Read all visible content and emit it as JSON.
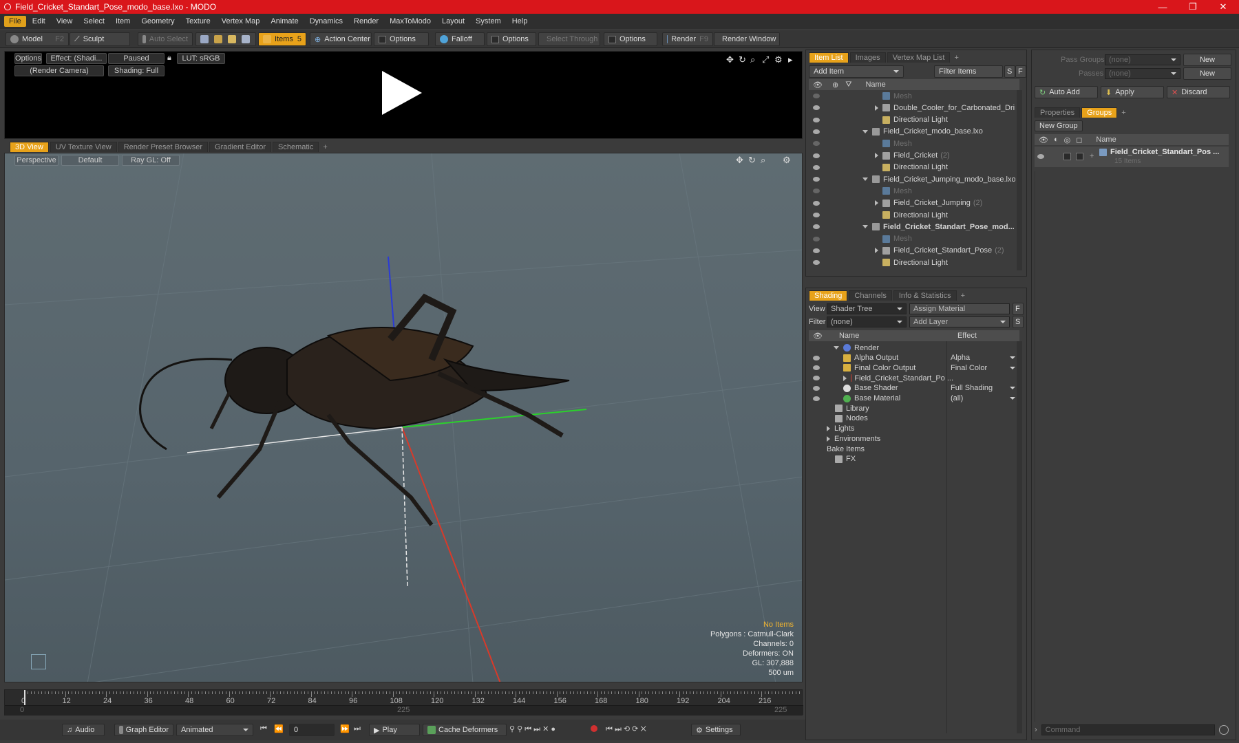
{
  "window": {
    "title": "Field_Cricket_Standart_Pose_modo_base.lxo - MODO",
    "minimize": "—",
    "maximize": "❐",
    "close": "✕"
  },
  "menu": [
    "File",
    "Edit",
    "View",
    "Select",
    "Item",
    "Geometry",
    "Texture",
    "Vertex Map",
    "Animate",
    "Dynamics",
    "Render",
    "MaxToModo",
    "Layout",
    "System",
    "Help"
  ],
  "toolbar": {
    "model": "Model",
    "model_key": "F2",
    "sculpt": "Sculpt",
    "auto_select": "Auto Select",
    "items": "Items",
    "items_key": "5",
    "action_center": "Action Center",
    "options1": "Options",
    "falloff": "Falloff",
    "options2": "Options",
    "select_through": "Select Through",
    "options3": "Options",
    "render": "Render",
    "render_key": "F9",
    "render_window": "Render Window"
  },
  "render_preview": {
    "options": "Options",
    "effect": "Effect: (Shadi...",
    "paused": "Paused",
    "lut": "LUT: sRGB",
    "camera": "(Render Camera)",
    "shading": "Shading: Full"
  },
  "view_tabs": [
    "3D View",
    "UV Texture View",
    "Render Preset Browser",
    "Gradient Editor",
    "Schematic"
  ],
  "viewport": {
    "perspective": "Perspective",
    "default": "Default",
    "raygl": "Ray GL: Off",
    "stats": {
      "no_items": "No Items",
      "polygons": "Polygons : Catmull-Clark",
      "channels": "Channels: 0",
      "deformers": "Deformers: ON",
      "gl": "GL: 307,888",
      "scale": "500 um"
    }
  },
  "timeline": {
    "ticks": [
      "0",
      "12",
      "24",
      "36",
      "48",
      "60",
      "72",
      "84",
      "96",
      "108",
      "120",
      "132",
      "144",
      "156",
      "168",
      "180",
      "192",
      "204",
      "216"
    ],
    "start": "0",
    "mid": "225",
    "end": "225"
  },
  "bottombar": {
    "audio": "Audio",
    "graph_editor": "Graph Editor",
    "animated": "Animated",
    "frame": "0",
    "play": "Play",
    "cache_deformers": "Cache Deformers",
    "settings": "Settings"
  },
  "item_list": {
    "tabs": [
      "Item List",
      "Images",
      "Vertex Map List"
    ],
    "add_item": "Add Item",
    "filter_items": "Filter Items",
    "s": "S",
    "f": "F",
    "name_col": "Name",
    "rows": [
      {
        "label": "Mesh",
        "count": ""
      },
      {
        "label": "Double_Cooler_for_Carbonated_Drink",
        "count": ""
      },
      {
        "label": "Directional Light",
        "count": ""
      },
      {
        "label": "Field_Cricket_modo_base.lxo",
        "count": ""
      },
      {
        "label": "Mesh",
        "count": ""
      },
      {
        "label": "Field_Cricket",
        "count": "(2)"
      },
      {
        "label": "Directional Light",
        "count": ""
      },
      {
        "label": "Field_Cricket_Jumping_modo_base.lxo",
        "count": ""
      },
      {
        "label": "Mesh",
        "count": ""
      },
      {
        "label": "Field_Cricket_Jumping",
        "count": "(2)"
      },
      {
        "label": "Directional Light",
        "count": ""
      },
      {
        "label": "Field_Cricket_Standart_Pose_mod...",
        "count": ""
      },
      {
        "label": "Mesh",
        "count": ""
      },
      {
        "label": "Field_Cricket_Standart_Pose",
        "count": "(2)"
      },
      {
        "label": "Directional Light",
        "count": ""
      }
    ]
  },
  "shading": {
    "tabs": [
      "Shading",
      "Channels",
      "Info & Statistics"
    ],
    "view_label": "View",
    "view_value": "Shader Tree",
    "assign_material": "Assign Material",
    "f": "F",
    "filter_label": "Filter",
    "filter_value": "(none)",
    "add_layer": "Add Layer",
    "s": "S",
    "name_col": "Name",
    "effect_col": "Effect",
    "rows": [
      {
        "label": "Render",
        "effect": ""
      },
      {
        "label": "Alpha Output",
        "effect": "Alpha"
      },
      {
        "label": "Final Color Output",
        "effect": "Final Color"
      },
      {
        "label": "Field_Cricket_Standart_Po ...",
        "effect": ""
      },
      {
        "label": "Base Shader",
        "effect": "Full Shading"
      },
      {
        "label": "Base Material",
        "effect": "(all)"
      },
      {
        "label": "Library",
        "effect": ""
      },
      {
        "label": "Nodes",
        "effect": ""
      },
      {
        "label": "Lights",
        "effect": ""
      },
      {
        "label": "Environments",
        "effect": ""
      },
      {
        "label": "Bake Items",
        "effect": ""
      },
      {
        "label": "FX",
        "effect": ""
      }
    ]
  },
  "groups": {
    "pass_groups_label": "Pass Groups",
    "pass_groups_value": "(none)",
    "new1": "New",
    "passes_label": "Passes",
    "passes_value": "(none)",
    "new2": "New",
    "auto_add": "Auto Add",
    "apply": "Apply",
    "discard": "Discard",
    "tabs": [
      "Properties",
      "Groups"
    ],
    "new_group": "New Group",
    "name_col": "Name",
    "item_name": "Field_Cricket_Standart_Pos ...",
    "item_sub": "15 Items"
  },
  "command": {
    "placeholder": "Command"
  }
}
